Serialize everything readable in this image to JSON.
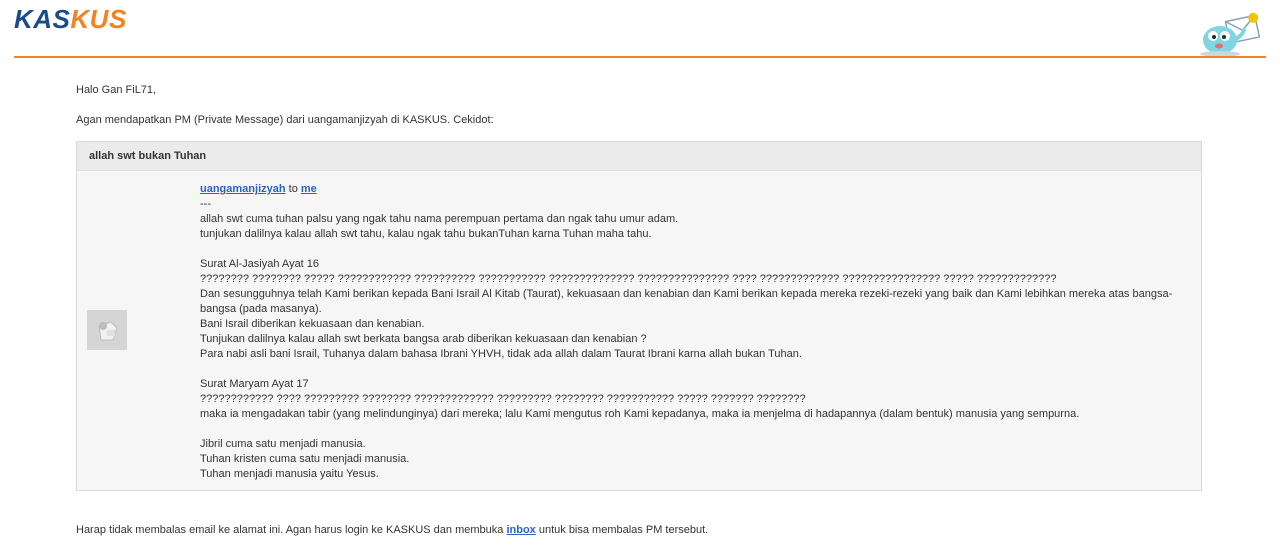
{
  "header": {
    "logo_part1": "KAS",
    "logo_part2": "KUS",
    "mascot_icon": "kaskus-mascot-mail-icon",
    "accent_color": "#f58220",
    "brand_color": "#1a4b8c"
  },
  "email": {
    "greeting": "Halo Gan FiL71,",
    "intro": "Agan mendapatkan PM (Private Message) dari uangamanjizyah di KASKUS. Cekidot:",
    "subject": "allah swt bukan Tuhan",
    "sender": "uangamanjizyah",
    "to_word": " to ",
    "recipient": "me",
    "separator": "---",
    "body_lines": [
      "allah swt cuma tuhan palsu yang ngak tahu nama perempuan pertama dan ngak tahu umur adam.",
      "tunjukan dalilnya kalau allah swt tahu, kalau ngak tahu bukanTuhan karna Tuhan maha tahu.",
      "",
      "Surat Al-Jasiyah Ayat 16",
      "???????? ???????? ????? ???????????? ?????????? ??????????? ?????????????? ??????????????? ???? ????????????? ???????????????? ????? ?????????????",
      "Dan sesungguhnya telah Kami berikan kepada Bani Israil Al Kitab (Taurat), kekuasaan dan kenabian dan Kami berikan kepada mereka rezeki-rezeki yang baik dan Kami lebihkan mereka atas bangsa-bangsa (pada masanya).",
      "Bani Israil diberikan kekuasaan dan kenabian.",
      "Tunjukan dalilnya kalau allah swt berkata bangsa arab diberikan kekuasaan dan kenabian ?",
      "Para nabi asli bani Israil, Tuhanya dalam bahasa Ibrani YHVH, tidak ada allah dalam Taurat Ibrani karna allah bukan Tuhan.",
      "",
      "Surat Maryam Ayat 17",
      "???????????? ???? ????????? ???????? ????????????? ????????? ???????? ??????????? ????? ??????? ????????",
      "maka ia mengadakan tabir (yang melindunginya) dari mereka; lalu Kami mengutus roh Kami kepadanya, maka ia menjelma di hadapannya (dalam bentuk) manusia yang sempurna.",
      "",
      "Jibril cuma satu menjadi manusia.",
      "Tuhan kristen cuma satu menjadi manusia.",
      "Tuhan menjadi manusia yaitu Yesus."
    ],
    "avatar_icon": "default-avatar-icon"
  },
  "footer": {
    "text_before": "Harap tidak membalas email ke alamat ini. Agan harus login ke KASKUS dan membuka ",
    "link_text": "inbox",
    "text_after": " untuk bisa membalas PM tersebut."
  }
}
